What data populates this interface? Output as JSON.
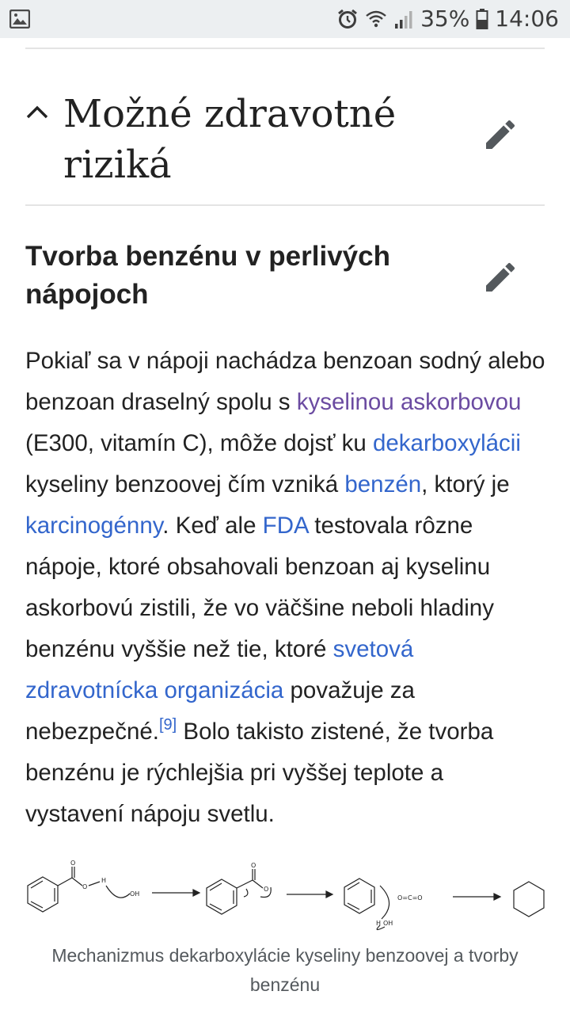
{
  "status_bar": {
    "battery": "35%",
    "time": "14:06",
    "icons": [
      "image-icon",
      "alarm-icon",
      "wifi-icon",
      "signal-icon",
      "battery-icon"
    ]
  },
  "section": {
    "title": "Možné zdravotné riziká",
    "icons": [
      "chevron-up-icon",
      "pencil-icon"
    ]
  },
  "subsection": {
    "title": "Tvorba benzénu v perlivých nápojoch"
  },
  "paragraph": {
    "t1": "Pokiaľ sa v nápoji nachádza benzoan sodný alebo benzoan draselný spolu s ",
    "link1": "kyselinou askorbovou",
    "t2": " (E300, vitamín C), môže dojsť ku ",
    "link2": "dekarboxylácii",
    "t3": " kyseliny benzoovej čím vzniká ",
    "link3": "benzén",
    "t4": ", ktorý je ",
    "link4": "karcinogénny",
    "t5": ". Keď ale ",
    "link5": "FDA",
    "t6": " testovala rôzne nápoje, ktoré obsahovali benzoan aj kyselinu askorbovú zistili, že vo väčšine neboli hladiny benzénu vyššie než tie, ktoré ",
    "link6": "svetová zdravotnícka organizácia",
    "t7": " považuje za nebezpečné.",
    "ref": "[9]",
    "t8": " Bolo takisto zistené, že tvorba benzénu je rýchlejšia pri vyššej teplote a vystavení nápoju svetlu."
  },
  "figure": {
    "labels": {
      "o1": "O",
      "o2": "O",
      "h1": "H",
      "oh1": "OH",
      "o3": "O",
      "o4": "O",
      "co2": "O=C=O",
      "h2": "H",
      "oh2": "OH"
    },
    "caption": "Mechanizmus dekarboxylácie kyseliny benzoovej a tvorby benzénu"
  },
  "colors": {
    "link": "#3366cc",
    "link_visited": "#6b4ba1",
    "text": "#222222",
    "status_bar_bg": "#eceff1"
  }
}
